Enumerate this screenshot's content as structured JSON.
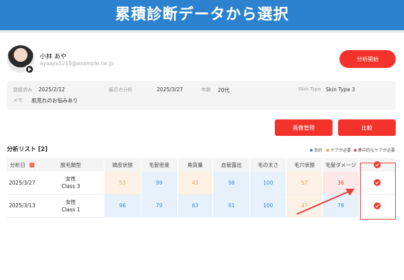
{
  "banner": {
    "title": "累積診断データから選択"
  },
  "profile": {
    "name": "小林 あや",
    "email": "ayaaya1218@example.ne.jp"
  },
  "buttons": {
    "analyze": "分析開始",
    "image_manage": "画像管理",
    "compare": "比較"
  },
  "info": {
    "registered_label": "登録済み",
    "registered_value": "2025/2/12",
    "recent_label": "最近の分析",
    "recent_value": "2025/3/27",
    "age_label": "年齢",
    "age_value": "20代",
    "skintype_label": "Skin Type",
    "skintype_value": "Skin Type 3",
    "memo_label": "メモ",
    "memo_value": "肌荒れのお悩みあり"
  },
  "list": {
    "title": "分析リスト [2]"
  },
  "legend": {
    "good": "良好",
    "care": "ケアが必要",
    "focus": "集中的なケアが必要",
    "colors": {
      "good": "#3a86d6",
      "care": "#f0a040",
      "focus": "#e24a4a"
    }
  },
  "table": {
    "headers": [
      "分析日",
      "脱毛類型",
      "頭皮状態",
      "毛髪密度",
      "角質量",
      "血管露出",
      "毛の太さ",
      "毛穴状態",
      "毛髪ダメージ"
    ],
    "rows": [
      {
        "date": "2025/3/27",
        "type1": "女性",
        "type2": "Class 3",
        "v": [
          "53",
          "99",
          "43",
          "98",
          "100",
          "57",
          "36"
        ]
      },
      {
        "date": "2025/3/13",
        "type1": "女性",
        "type2": "Class 1",
        "v": [
          "96",
          "79",
          "63",
          "91",
          "100",
          "47",
          "78"
        ]
      }
    ]
  }
}
